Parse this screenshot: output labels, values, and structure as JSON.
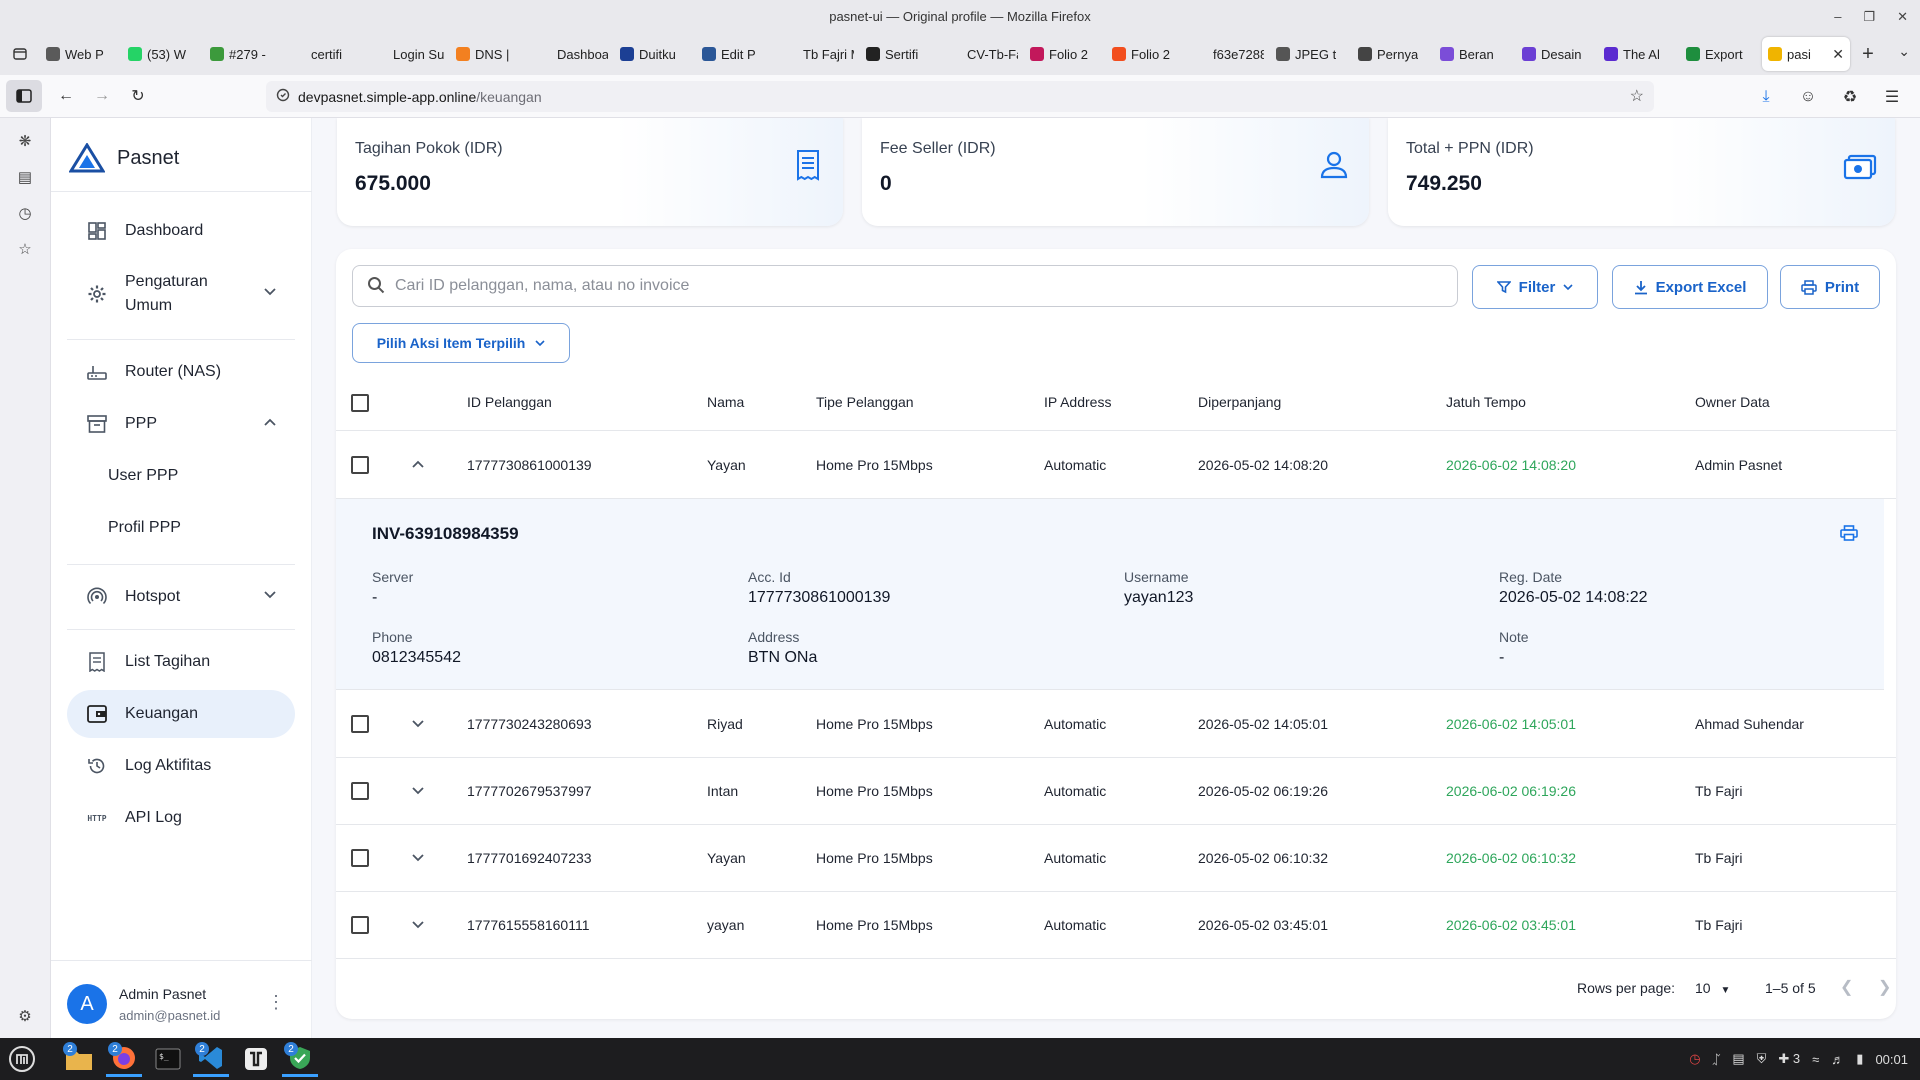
{
  "window": {
    "title": "pasnet-ui — Original profile — Mozilla Firefox"
  },
  "tabs": [
    {
      "label": "Web P",
      "color": "#5a5a5a"
    },
    {
      "label": "(53) W",
      "color": "#25d366"
    },
    {
      "label": "#279 -",
      "color": "#3c9a3c"
    },
    {
      "label": "certifi",
      "color": "#e9e9ed"
    },
    {
      "label": "Login Sup",
      "color": "#e9e9ed"
    },
    {
      "label": "DNS | ",
      "color": "#f38020"
    },
    {
      "label": "Dashboar",
      "color": "#e9e9ed"
    },
    {
      "label": "Duitku",
      "color": "#1c3f94"
    },
    {
      "label": "Edit P",
      "color": "#2b5797"
    },
    {
      "label": "Tb Fajri M",
      "color": "#e9e9ed"
    },
    {
      "label": "Sertifi",
      "color": "#222222"
    },
    {
      "label": "CV-Tb-Faj",
      "color": "#e9e9ed"
    },
    {
      "label": "Folio 2",
      "color": "#c2185b"
    },
    {
      "label": "Folio 2",
      "color": "#f24e1e"
    },
    {
      "label": "f63e7288",
      "color": "#e9e9ed"
    },
    {
      "label": "JPEG t",
      "color": "#555555"
    },
    {
      "label": "Pernya",
      "color": "#444444"
    },
    {
      "label": "Beran",
      "color": "#7b4dd8"
    },
    {
      "label": "Desain",
      "color": "#6b3fd4"
    },
    {
      "label": "The Al",
      "color": "#5b2bd0"
    },
    {
      "label": "Export",
      "color": "#1e8e3e"
    },
    {
      "label": "pasi",
      "color": "#f0b400",
      "active": true
    }
  ],
  "url": {
    "host": "devpasnet.simple-app.online",
    "path": "/keuangan"
  },
  "brand": {
    "name": "Pasnet"
  },
  "sidebar": {
    "items": [
      {
        "label": "Dashboard"
      },
      {
        "label": "Pengaturan",
        "label2": "Umum"
      },
      {
        "label": "Router (NAS)"
      },
      {
        "label": "PPP"
      },
      {
        "label": "User PPP"
      },
      {
        "label": "Profil PPP"
      },
      {
        "label": "Hotspot"
      },
      {
        "label": "List Tagihan"
      },
      {
        "label": "Keuangan"
      },
      {
        "label": "Log Aktifitas"
      },
      {
        "label": "API Log"
      }
    ]
  },
  "user": {
    "initial": "A",
    "name": "Admin Pasnet",
    "email": "admin@pasnet.id"
  },
  "stats": [
    {
      "label": "Tagihan Pokok (IDR)",
      "value": "675.000"
    },
    {
      "label": "Fee Seller (IDR)",
      "value": "0"
    },
    {
      "label": "Total + PPN (IDR)",
      "value": "749.250"
    }
  ],
  "toolbar": {
    "search_placeholder": "Cari ID pelanggan, nama, atau no invoice",
    "filter": "Filter",
    "export": "Export Excel",
    "print": "Print",
    "bulk_action": "Pilih Aksi Item Terpilih"
  },
  "table": {
    "headers": [
      "ID Pelanggan",
      "Nama",
      "Tipe Pelanggan",
      "IP Address",
      "Diperpanjang",
      "Jatuh Tempo",
      "Owner Data"
    ],
    "rows": [
      [
        "1777730861000139",
        "Yayan",
        "Home Pro 15Mbps",
        "Automatic",
        "2026-05-02 14:08:20",
        "2026-06-02 14:08:20",
        "Admin Pasnet"
      ],
      [
        "1777730243280693",
        "Riyad",
        "Home Pro 15Mbps",
        "Automatic",
        "2026-05-02 14:05:01",
        "2026-06-02 14:05:01",
        "Ahmad Suhendar"
      ],
      [
        "1777702679537997",
        "Intan",
        "Home Pro 15Mbps",
        "Automatic",
        "2026-05-02 06:19:26",
        "2026-06-02 06:19:26",
        "Tb Fajri"
      ],
      [
        "1777701692407233",
        "Yayan",
        "Home Pro 15Mbps",
        "Automatic",
        "2026-05-02 06:10:32",
        "2026-06-02 06:10:32",
        "Tb Fajri"
      ],
      [
        "1777615558160111",
        "yayan",
        "Home Pro 15Mbps",
        "Automatic",
        "2026-05-02 03:45:01",
        "2026-06-02 03:45:01",
        "Tb Fajri"
      ]
    ]
  },
  "detail": {
    "invoice": "INV-639108984359",
    "fields": [
      {
        "label": "Server",
        "value": "-"
      },
      {
        "label": "Acc. Id",
        "value": "1777730861000139"
      },
      {
        "label": "Username",
        "value": "yayan123"
      },
      {
        "label": "Reg. Date",
        "value": "2026-05-02 14:08:22"
      },
      {
        "label": "Phone",
        "value": "0812345542"
      },
      {
        "label": "Address",
        "value": "BTN ONa"
      },
      {
        "label": "Note",
        "value": "-"
      }
    ]
  },
  "pagination": {
    "rows_label": "Rows per page:",
    "rows_value": "10",
    "range": "1–5 of 5"
  },
  "taskbar": {
    "clock": "00:01",
    "tray_count": "3",
    "badge": "2"
  },
  "colors": {
    "accent": "#1a73e8",
    "due": "#2ea65b",
    "active_bg": "#e8f0fb"
  }
}
